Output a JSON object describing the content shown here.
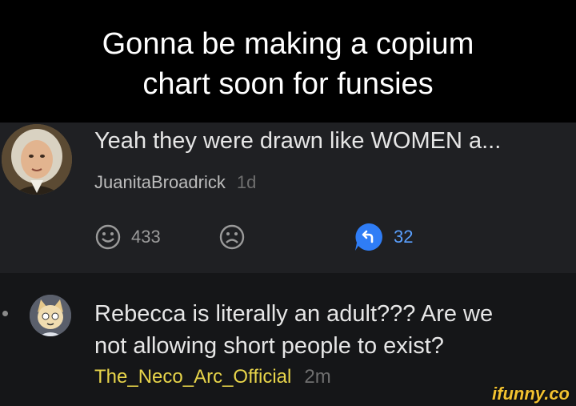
{
  "caption": {
    "line1": "Gonna be making a copium",
    "line2": "chart soon for funsies"
  },
  "comment1": {
    "text": "Yeah they were drawn like WOMEN a...",
    "username": "JuanitaBroadrick",
    "time": "1d",
    "smile_count": "433",
    "reply_count": "32"
  },
  "comment2": {
    "text_line1": "Rebecca is literally an adult??? Are we",
    "text_line2": "not allowing short people to exist?",
    "username": "The_Neco_Arc_Official",
    "time": "2m"
  },
  "watermark": "ifunny.co",
  "colors": {
    "caption_bg": "#000000",
    "comment_bg": "#1f2023",
    "username_highlight": "#e7d44a",
    "reply_accent": "#2f7df6"
  }
}
